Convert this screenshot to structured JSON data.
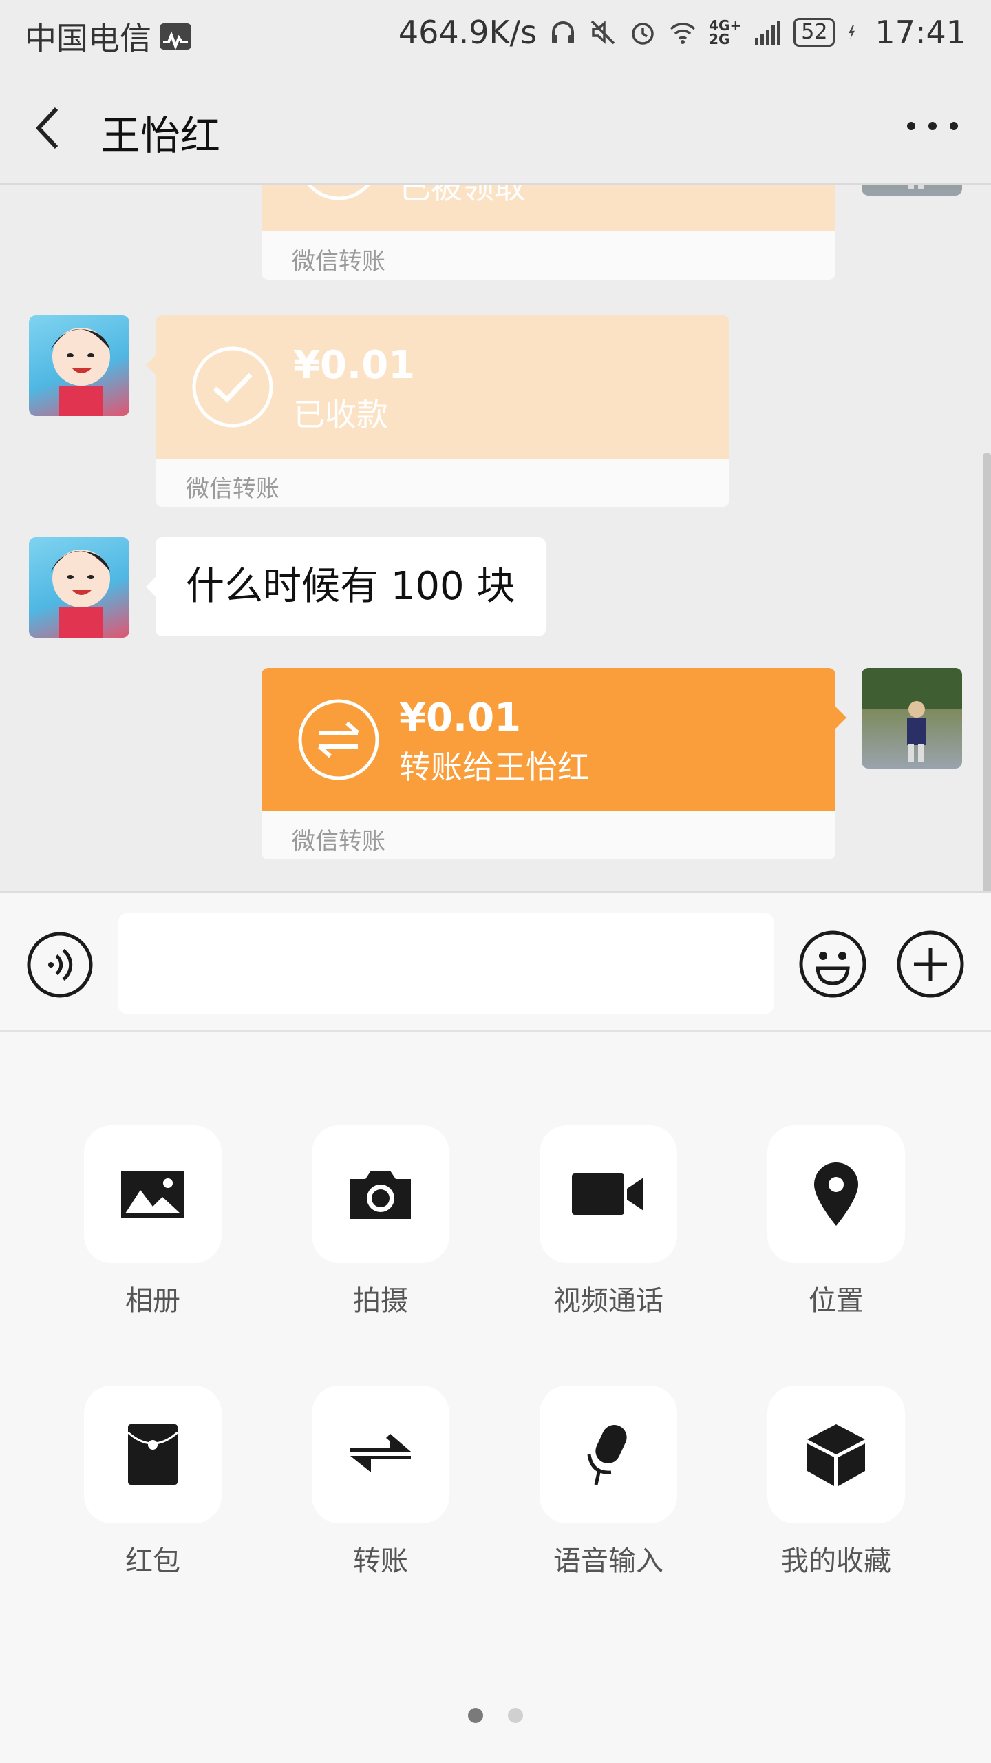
{
  "status_bar": {
    "carrier": "中国电信",
    "speed": "464.9K/s",
    "network": "4G+\n2G",
    "battery": "52",
    "time": "17:41"
  },
  "header": {
    "title": "王怡红",
    "back_icon": "chevron-left-icon",
    "more_icon": "more-dots-icon"
  },
  "messages": [
    {
      "side": "right",
      "type": "transfer",
      "style": "received",
      "status": "已被领取",
      "footer": "微信转账",
      "cropped": true
    },
    {
      "side": "left",
      "type": "transfer",
      "style": "received",
      "amount": "¥0.01",
      "status": "已收款",
      "footer": "微信转账"
    },
    {
      "side": "left",
      "type": "text",
      "text": "什么时候有 100 块"
    },
    {
      "side": "right",
      "type": "transfer",
      "style": "sent",
      "amount": "¥0.01",
      "status": "转账给王怡红",
      "footer": "微信转账"
    }
  ],
  "input_bar": {
    "voice_icon": "voice-icon",
    "placeholder": "",
    "emoji_icon": "emoji-icon",
    "plus_icon": "plus-icon"
  },
  "tools": [
    {
      "label": "相册",
      "icon": "image-icon"
    },
    {
      "label": "拍摄",
      "icon": "camera-icon"
    },
    {
      "label": "视频通话",
      "icon": "video-call-icon"
    },
    {
      "label": "位置",
      "icon": "location-icon"
    },
    {
      "label": "红包",
      "icon": "red-packet-icon"
    },
    {
      "label": "转账",
      "icon": "transfer-icon"
    },
    {
      "label": "语音输入",
      "icon": "microphone-icon"
    },
    {
      "label": "我的收藏",
      "icon": "favorites-cube-icon"
    }
  ],
  "pager": {
    "pages": 2,
    "current": 1
  },
  "colors": {
    "background": "#ededed",
    "transfer_sent": "#fa9d3b",
    "transfer_received": "#fce2c4",
    "panel": "#f7f7f7"
  }
}
